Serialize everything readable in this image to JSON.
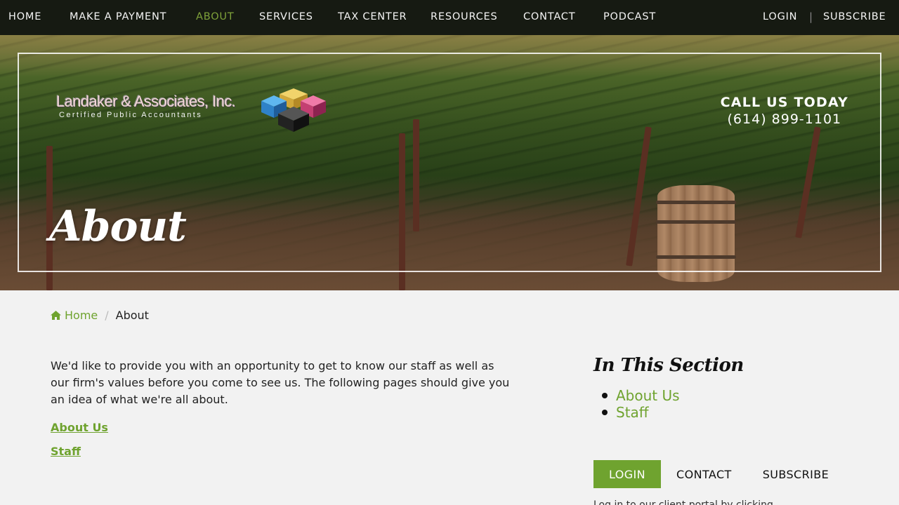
{
  "nav": {
    "items": [
      {
        "label": "HOME",
        "active": false
      },
      {
        "label": "MAKE A PAYMENT",
        "active": false
      },
      {
        "label": "ABOUT",
        "active": true
      },
      {
        "label": "SERVICES",
        "active": false
      },
      {
        "label": "TAX CENTER",
        "active": false
      },
      {
        "label": "RESOURCES",
        "active": false
      },
      {
        "label": "CONTACT",
        "active": false
      },
      {
        "label": "PODCAST",
        "active": false
      }
    ],
    "login": "LOGIN",
    "separator": "|",
    "subscribe": "SUBSCRIBE"
  },
  "header": {
    "logo_name": "Landaker & Associates, Inc.",
    "logo_tagline": "Certified Public Accountants",
    "call_label": "CALL US TODAY",
    "phone": "(614) 899-1101",
    "page_title": "About"
  },
  "breadcrumb": {
    "home": "Home",
    "divider": "/",
    "current": "About"
  },
  "main": {
    "intro": "We'd like to provide you with an opportunity to get to know our staff as well as our firm's values before you come to see us. The following pages should give you an idea of what we're all about.",
    "links": [
      "About Us",
      "Staff"
    ]
  },
  "sidebar": {
    "title": "In This Section",
    "items": [
      "About Us",
      "Staff"
    ],
    "tabs": [
      {
        "label": "LOGIN",
        "active": true
      },
      {
        "label": "CONTACT",
        "active": false
      },
      {
        "label": "SUBSCRIBE",
        "active": false
      }
    ],
    "note": "Log in to our client portal by clicking"
  },
  "colors": {
    "accent": "#6fa32f",
    "nav_bg": "#161a12",
    "nav_active": "#7fa23a"
  },
  "icons": {
    "breadcrumb_home": "home-icon"
  }
}
